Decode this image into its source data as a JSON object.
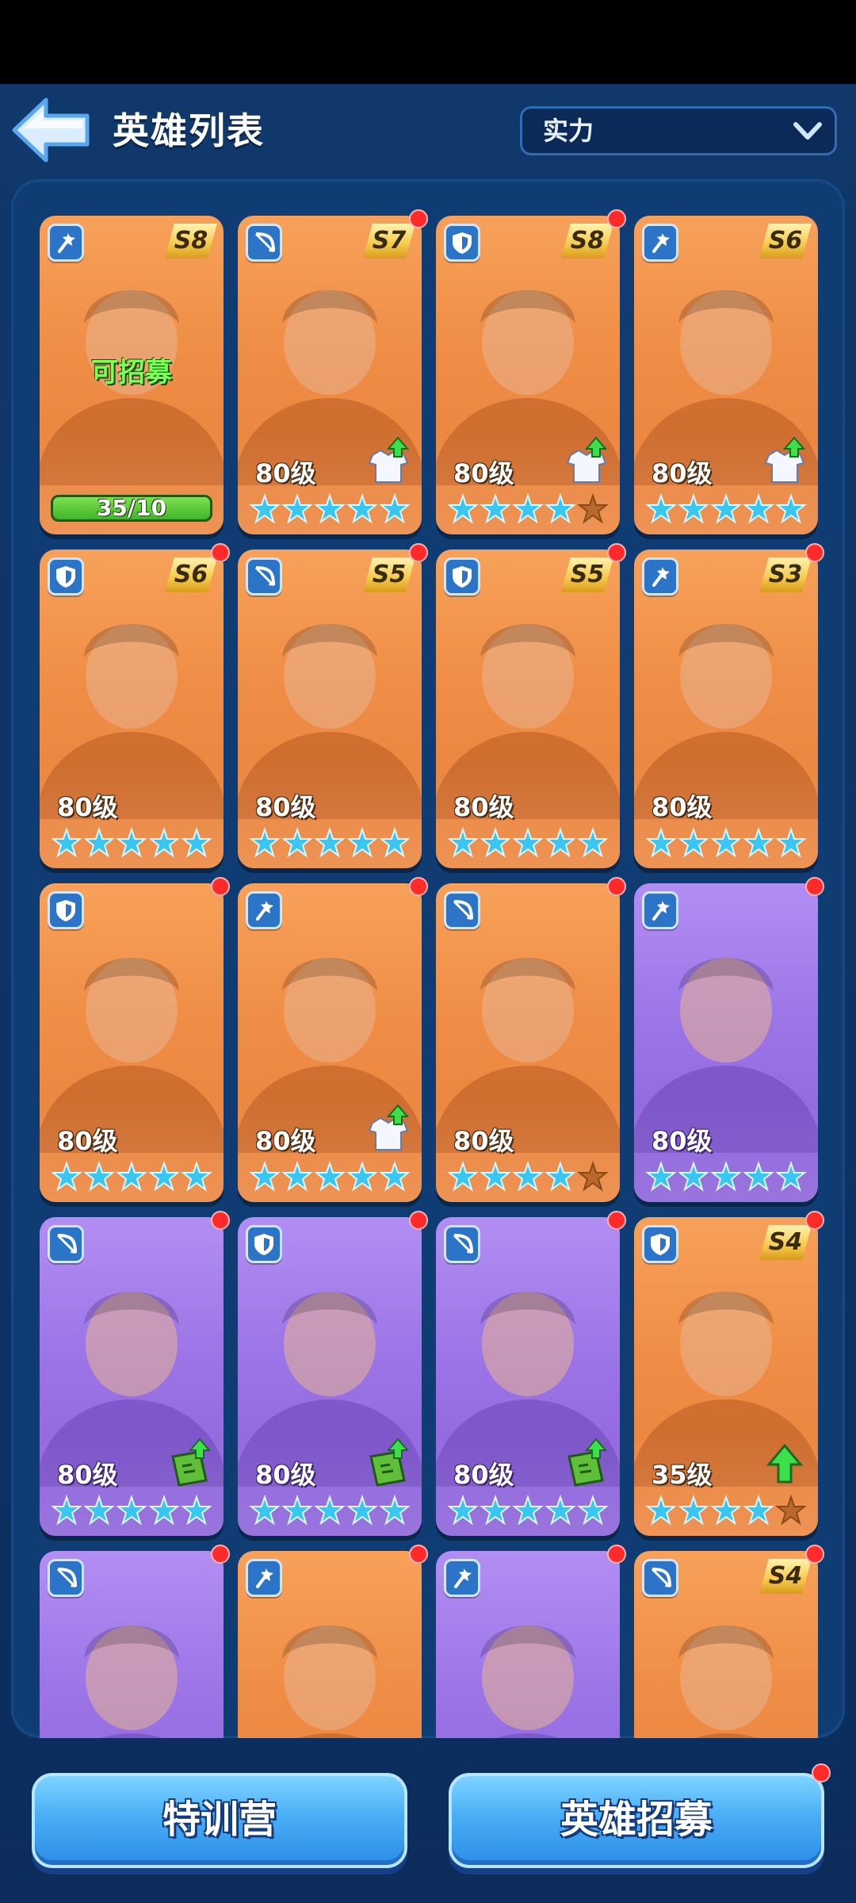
{
  "header": {
    "title": "英雄列表",
    "back_icon": "arrow-left-icon"
  },
  "sort": {
    "label": "实力",
    "icon": "chevron-down-icon"
  },
  "heroes": [
    {
      "type": "wand",
      "season": "S8",
      "bg": "orange",
      "dot": false,
      "recruit": true,
      "recruit_text": "可招募",
      "shards": "35/10",
      "level": "",
      "stars": 0,
      "upgrade": ""
    },
    {
      "type": "bow",
      "season": "S7",
      "bg": "orange",
      "dot": true,
      "level": "80级",
      "stars": 5,
      "upgrade": "outfit"
    },
    {
      "type": "shield",
      "season": "S8",
      "bg": "orange",
      "dot": true,
      "level": "80级",
      "stars": 4,
      "upgrade": "outfit"
    },
    {
      "type": "wand",
      "season": "S6",
      "bg": "orange",
      "dot": false,
      "level": "80级",
      "stars": 5,
      "upgrade": "outfit"
    },
    {
      "type": "shield",
      "season": "S6",
      "bg": "orange",
      "dot": true,
      "level": "80级",
      "stars": 5,
      "upgrade": ""
    },
    {
      "type": "bow",
      "season": "S5",
      "bg": "orange",
      "dot": true,
      "level": "80级",
      "stars": 5,
      "upgrade": ""
    },
    {
      "type": "shield",
      "season": "S5",
      "bg": "orange",
      "dot": true,
      "level": "80级",
      "stars": 5,
      "upgrade": ""
    },
    {
      "type": "wand",
      "season": "S3",
      "bg": "orange",
      "dot": true,
      "level": "80级",
      "stars": 5,
      "upgrade": ""
    },
    {
      "type": "shield",
      "season": "",
      "bg": "orange",
      "dot": true,
      "level": "80级",
      "stars": 5,
      "upgrade": ""
    },
    {
      "type": "wand",
      "season": "",
      "bg": "orange",
      "dot": true,
      "level": "80级",
      "stars": 5,
      "upgrade": "outfit"
    },
    {
      "type": "bow",
      "season": "",
      "bg": "orange",
      "dot": true,
      "level": "80级",
      "stars": 4,
      "upgrade": ""
    },
    {
      "type": "wand",
      "season": "",
      "bg": "purple",
      "dot": true,
      "level": "80级",
      "stars": 5,
      "upgrade": ""
    },
    {
      "type": "bow",
      "season": "",
      "bg": "purple",
      "dot": true,
      "level": "80级",
      "stars": 5,
      "upgrade": "book"
    },
    {
      "type": "shield",
      "season": "",
      "bg": "purple",
      "dot": true,
      "level": "80级",
      "stars": 5,
      "upgrade": "book"
    },
    {
      "type": "bow",
      "season": "",
      "bg": "purple",
      "dot": true,
      "level": "80级",
      "stars": 5,
      "upgrade": "book"
    },
    {
      "type": "shield",
      "season": "S4",
      "bg": "orange",
      "dot": true,
      "level": "35级",
      "stars": 4,
      "upgrade": "arrow"
    },
    {
      "type": "bow",
      "season": "",
      "bg": "purple",
      "dot": true,
      "level": "",
      "stars": 0,
      "upgrade": ""
    },
    {
      "type": "wand",
      "season": "",
      "bg": "orange",
      "dot": true,
      "level": "",
      "stars": 0,
      "upgrade": ""
    },
    {
      "type": "wand",
      "season": "",
      "bg": "purple",
      "dot": true,
      "level": "",
      "stars": 0,
      "upgrade": ""
    },
    {
      "type": "bow",
      "season": "S4",
      "bg": "orange",
      "dot": true,
      "level": "",
      "stars": 0,
      "upgrade": ""
    }
  ],
  "buttons": {
    "training": "特训营",
    "recruit": "英雄招募",
    "recruit_dot": true
  },
  "colors": {
    "accent": "#2c74c8",
    "star": "#39c6f0",
    "dot": "#ff2b2b"
  }
}
